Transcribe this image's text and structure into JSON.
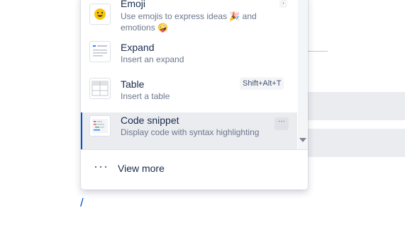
{
  "menu": {
    "items": [
      {
        "title": "Emoji",
        "description": "Use emojis to express ideas 🎉 and emotions 🤪",
        "shortcut": ":",
        "icon": "emoji-icon"
      },
      {
        "title": "Expand",
        "description": "Insert an expand",
        "icon": "expand-icon"
      },
      {
        "title": "Table",
        "description": "Insert a table",
        "shortcut": "Shift+Alt+T",
        "icon": "table-icon"
      },
      {
        "title": "Code snippet",
        "description": "Display code with syntax highlighting",
        "more_glyph": "···",
        "icon": "code-snippet-icon",
        "selected": true
      }
    ],
    "view_more": {
      "glyph": "···",
      "label": "View more"
    }
  },
  "editor": {
    "cursor_text": "/"
  },
  "colors": {
    "accent": "#0052cc",
    "selected_bg": "#ebecf0",
    "text": "#172b4d",
    "subtle_text": "#6b778c"
  }
}
